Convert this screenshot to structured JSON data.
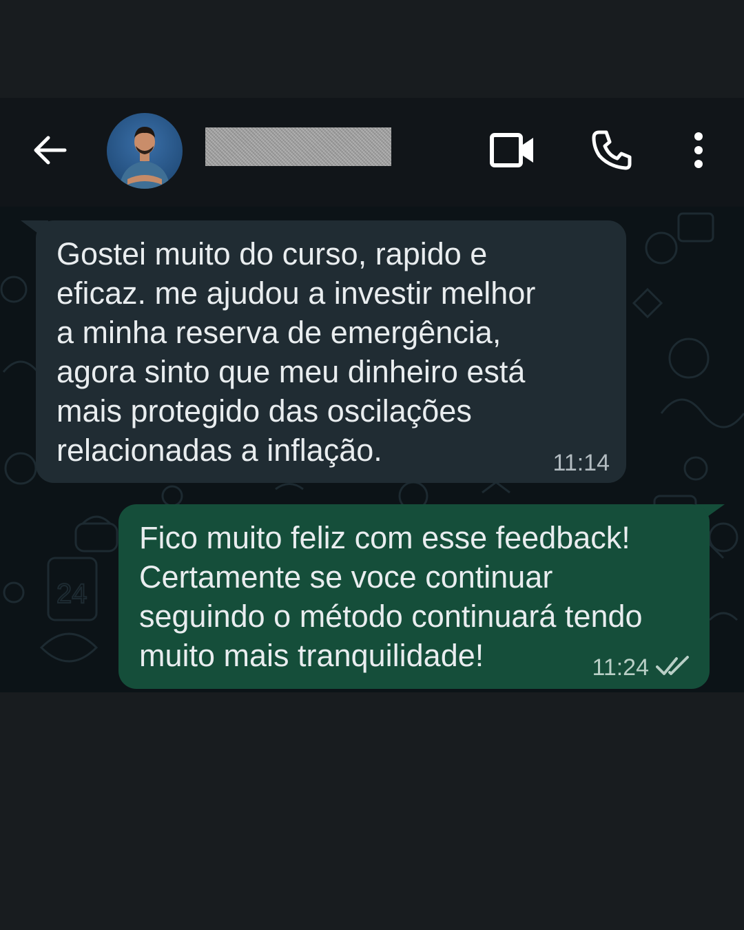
{
  "header": {
    "back_icon": "arrow-left-icon",
    "avatar_icon": "contact-avatar",
    "contact_name": "",
    "video_icon": "video-camera-icon",
    "call_icon": "phone-icon",
    "menu_icon": "more-vertical-icon",
    "background_color": "#111519",
    "icon_color": "#ffffff"
  },
  "chat": {
    "background_color": "#0c1317",
    "messages": [
      {
        "direction": "incoming",
        "text": "Gostei muito do curso, rapido e\neficaz. me ajudou a investir melhor\na minha reserva de emergência,\nagora sinto que meu dinheiro está\nmais protegido das oscilações\nrelacionadas a inflação.",
        "time": "11:14",
        "bubble_color": "#202c33"
      },
      {
        "direction": "outgoing",
        "text": "Fico muito feliz com esse feedback!\nCertamente se voce continuar\nseguindo o método continuará tendo\nmuito mais tranquilidade!",
        "time": "11:24",
        "status_icon": "double-check-icon",
        "bubble_color": "#154e3a"
      }
    ]
  }
}
